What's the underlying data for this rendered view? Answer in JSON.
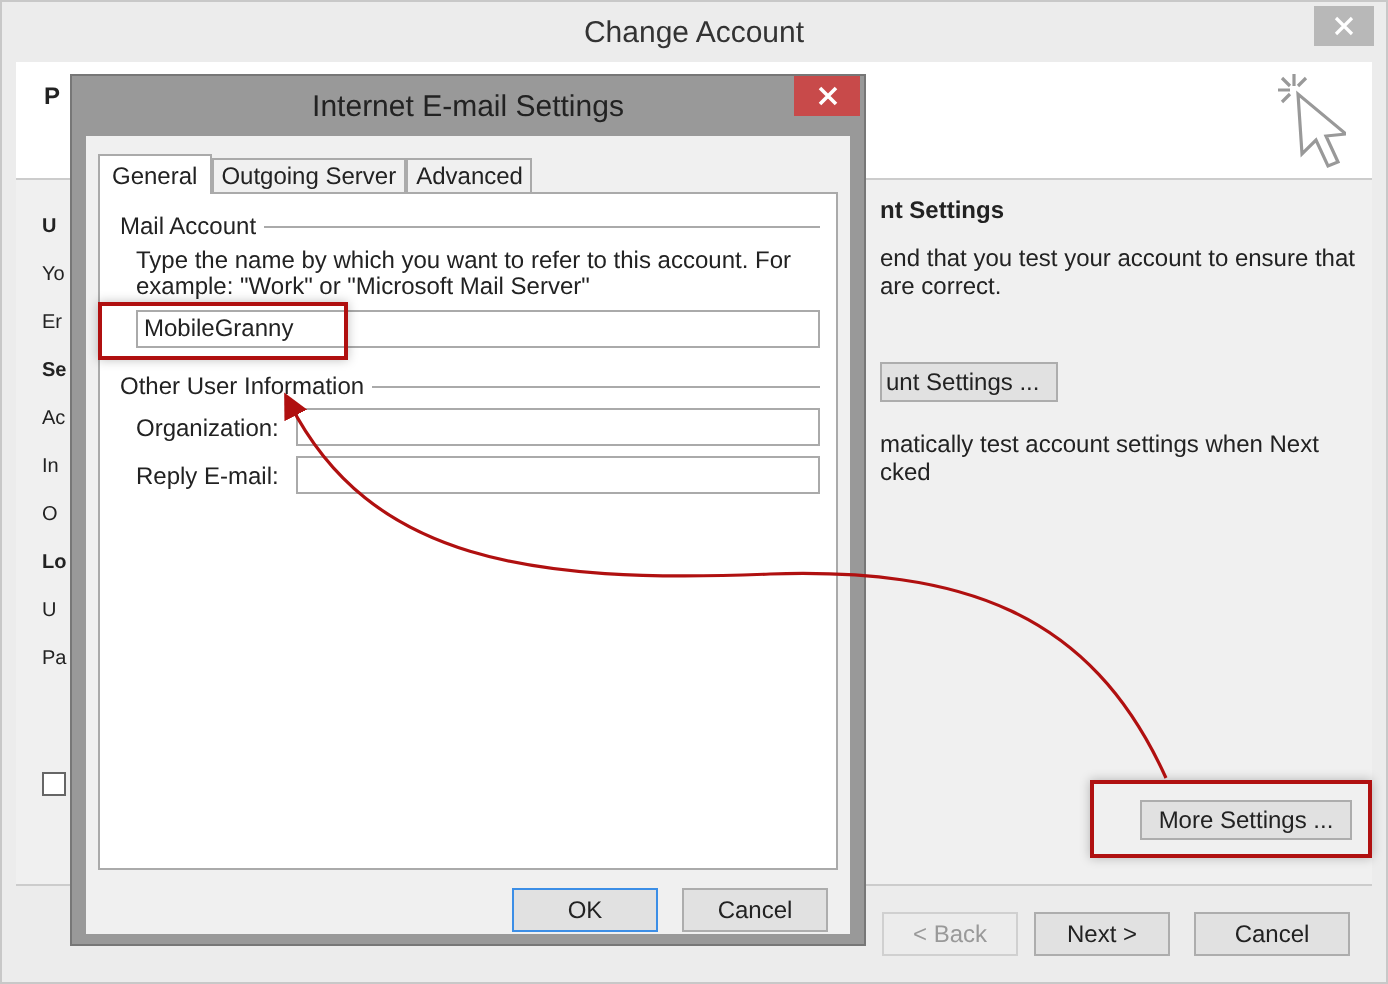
{
  "window": {
    "title": "Change Account"
  },
  "header": {
    "title_fragment": "P"
  },
  "left_fragments": [
    {
      "text": "U",
      "kind": "heading"
    },
    {
      "text": "Yo",
      "kind": "label"
    },
    {
      "text": "Er",
      "kind": "label"
    },
    {
      "text": "Se",
      "kind": "heading"
    },
    {
      "text": "Ac",
      "kind": "label"
    },
    {
      "text": "In",
      "kind": "label"
    },
    {
      "text": "O",
      "kind": "label"
    },
    {
      "text": "Lo",
      "kind": "heading"
    },
    {
      "text": "U",
      "kind": "label"
    },
    {
      "text": "Pa",
      "kind": "label"
    }
  ],
  "left_checkbox": {
    "checked": false
  },
  "right_blocks": [
    {
      "kind": "heading",
      "lines": [
        "nt Settings"
      ]
    },
    {
      "kind": "paragraph",
      "lines": [
        "end that you test your account to ensure that",
        "are correct."
      ]
    },
    {
      "kind": "button",
      "lines": [
        "unt Settings ..."
      ]
    },
    {
      "kind": "paragraph",
      "lines": [
        "matically test account settings when Next",
        "cked"
      ]
    }
  ],
  "more_settings_button": "More Settings ...",
  "buttons": [
    {
      "label": "< Back",
      "disabled": true
    },
    {
      "label": "Next >",
      "disabled": false
    },
    {
      "label": "Cancel",
      "disabled": false
    }
  ],
  "dialog": {
    "title": "Internet E-mail Settings",
    "tabs": [
      {
        "label": "General",
        "selected": true
      },
      {
        "label": "Outgoing Server",
        "selected": false
      },
      {
        "label": "Advanced",
        "selected": false
      }
    ],
    "mail_account": {
      "heading": "Mail Account",
      "instructions": "Type the name by which you want to refer to this account. For example: \"Work\" or \"Microsoft Mail Server\"",
      "account_name": "MobileGranny"
    },
    "other_user_info": {
      "heading": "Other User Information",
      "fields": [
        {
          "label": "Organization:"
        },
        {
          "label": "Reply E-mail:"
        }
      ]
    },
    "buttons": [
      {
        "label": "OK",
        "default": true
      },
      {
        "label": "Cancel",
        "default": false
      }
    ]
  }
}
